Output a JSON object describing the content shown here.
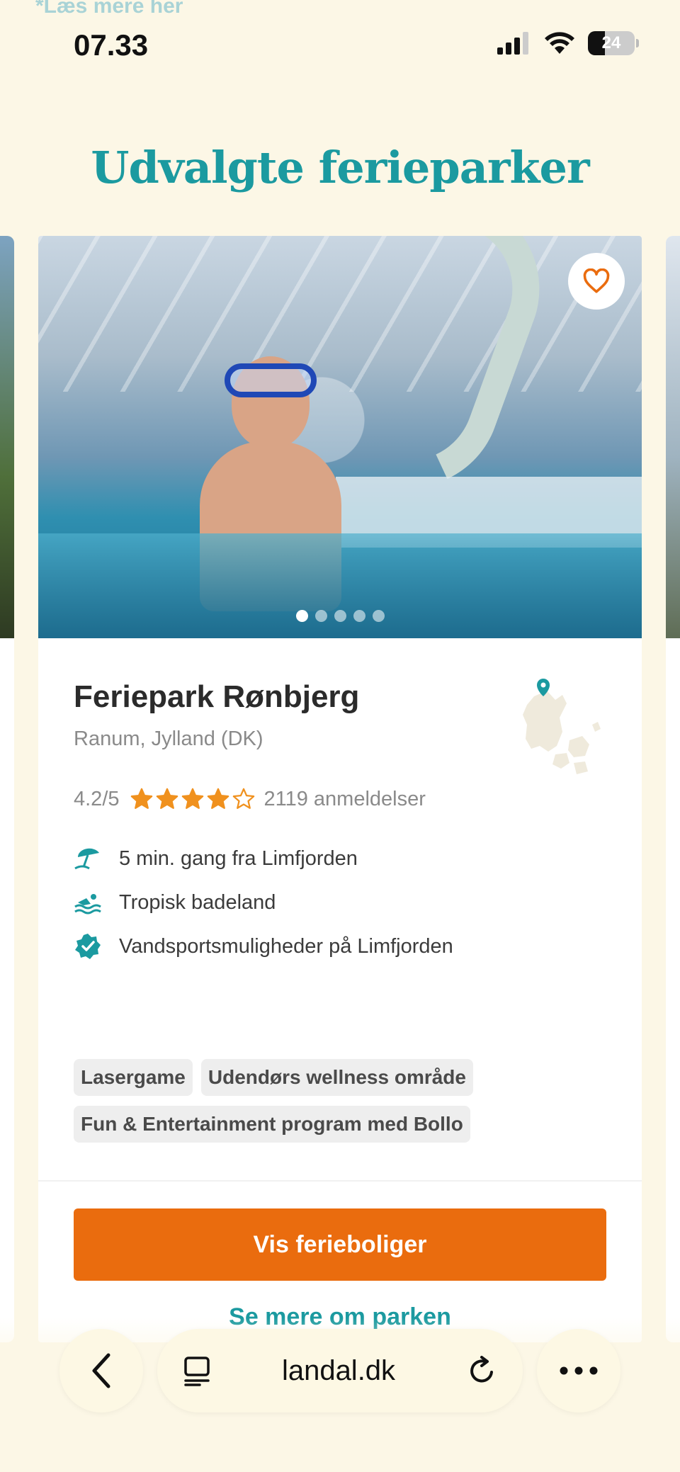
{
  "peek": {
    "text": "*Læs mere her"
  },
  "status_bar": {
    "time": "07.33",
    "battery": "24"
  },
  "section": {
    "title": "Udvalgte ferieparker"
  },
  "card": {
    "name": "Feriepark Rønbjerg",
    "location": "Ranum, Jylland (DK)",
    "rating_text": "4.2/5",
    "stars": 4,
    "stars_max": 5,
    "reviews": "2119 anmeldelser",
    "carousel_pages": 5,
    "carousel_active": 0,
    "features": [
      {
        "icon": "beach-umbrella-icon",
        "label": "5 min. gang fra Limfjorden"
      },
      {
        "icon": "swimming-icon",
        "label": "Tropisk badeland"
      },
      {
        "icon": "verified-badge-icon",
        "label": "Vandsportsmuligheder på Limfjorden"
      }
    ],
    "tags": [
      "Lasergame",
      "Udendørs wellness område",
      "Fun & Entertainment program med Bollo"
    ],
    "cta_label": "Vis ferieboliger",
    "more_label": "Se mere om parken"
  },
  "browser": {
    "url": "landal.dk"
  },
  "colors": {
    "accent_teal": "#1b9aa0",
    "cta_orange": "#ea6c0e",
    "star_orange": "#f0911e",
    "background": "#fcf7e6"
  }
}
